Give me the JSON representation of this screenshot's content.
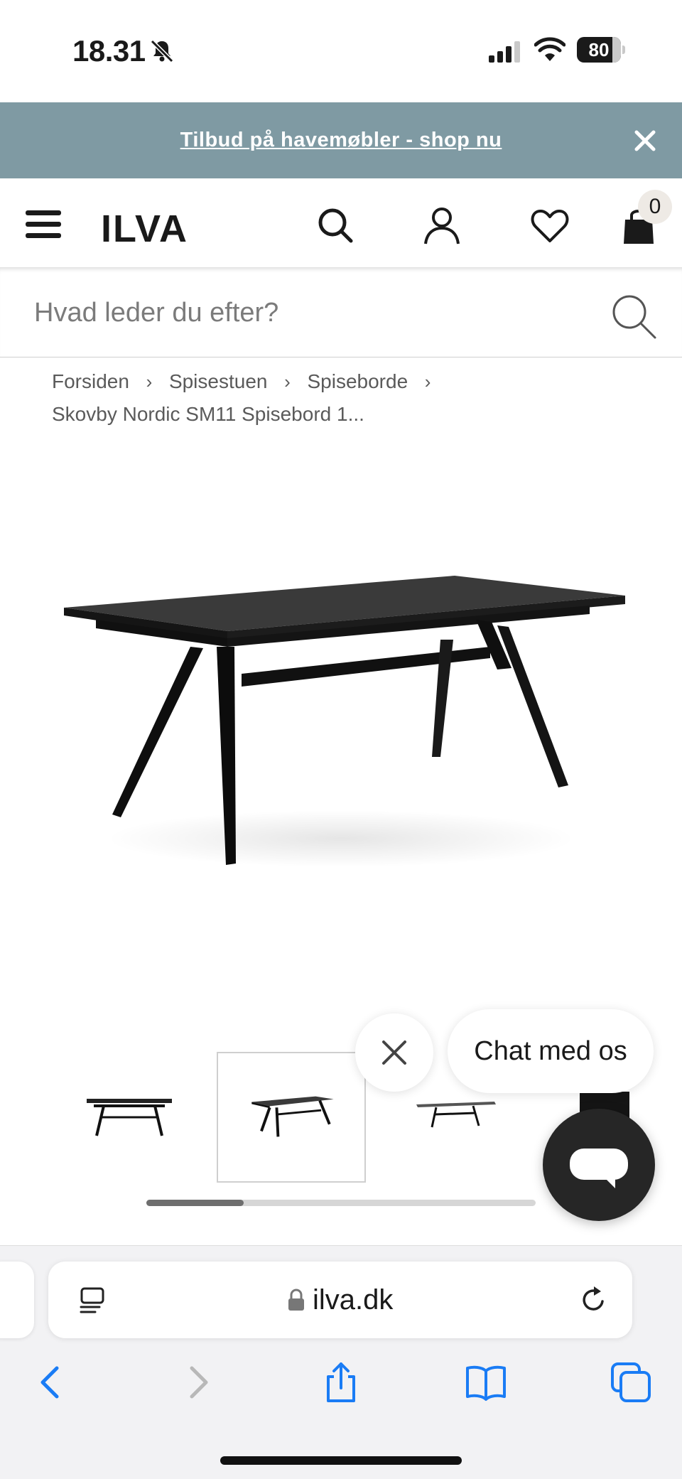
{
  "status_bar": {
    "time": "18.31",
    "battery": "80",
    "battery_level": 0.8
  },
  "promo": {
    "text": "Tilbud på havemøbler - shop nu"
  },
  "header": {
    "logo": "ILVA",
    "cart_count": "0"
  },
  "search": {
    "placeholder": "Hvad leder du efter?"
  },
  "breadcrumb": {
    "items": [
      "Forsiden",
      "Spisestuen",
      "Spiseborde"
    ],
    "current": "Skovby Nordic SM11 Spisebord 1...",
    "separator": "›"
  },
  "product": {
    "image": "dining-table-black",
    "thumbnails": [
      "table-side-view",
      "table-angled-view",
      "table-extended-view",
      "table-detail-view"
    ],
    "active_thumbnail": 1,
    "gallery_progress": 0.25
  },
  "chat": {
    "label": "Chat med os"
  },
  "browser": {
    "url": "ilva.dk",
    "accent": "#1a73e8"
  },
  "colors": {
    "promo_bg": "#7f9aa3",
    "text": "#1a1a1a",
    "ios_blue": "#1a7cf5"
  }
}
